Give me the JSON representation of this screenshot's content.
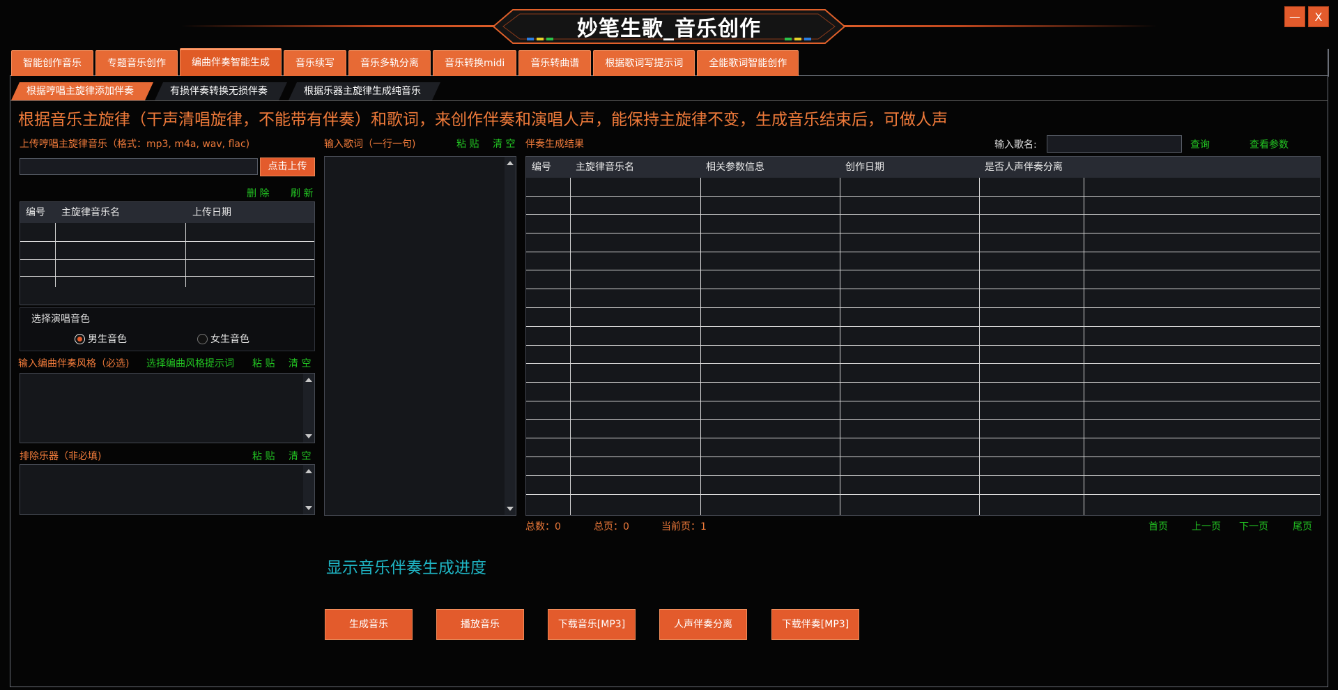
{
  "window": {
    "title": "妙笔生歌_音乐创作",
    "minimize_label": "—",
    "close_label": "X"
  },
  "tabs": [
    {
      "label": "智能创作音乐"
    },
    {
      "label": "专题音乐创作"
    },
    {
      "label": "编曲伴奏智能生成"
    },
    {
      "label": "音乐续写"
    },
    {
      "label": "音乐多轨分离"
    },
    {
      "label": "音乐转换midi"
    },
    {
      "label": "音乐转曲谱"
    },
    {
      "label": "根据歌词写提示词"
    },
    {
      "label": "全能歌词智能创作"
    }
  ],
  "subtabs": [
    {
      "label": "根据哼唱主旋律添加伴奏"
    },
    {
      "label": "有损伴奏转换无损伴奏"
    },
    {
      "label": "根据乐器主旋律生成纯音乐"
    }
  ],
  "description": "根据音乐主旋律（干声清唱旋律，不能带有伴奏）和歌词，来创作伴奏和演唱人声，能保持主旋律不变，生成音乐结束后，可做人声",
  "upload": {
    "label": "上传哼唱主旋律音乐（格式：mp3, m4a, wav, flac)",
    "path_value": "",
    "button": "点击上传",
    "delete": "删 除",
    "refresh": "刷 新",
    "table_headers": [
      "编号",
      "主旋律音乐名",
      "上传日期"
    ]
  },
  "voice": {
    "title": "选择演唱音色",
    "male": "男生音色",
    "female": "女生音色"
  },
  "style": {
    "label": "输入编曲伴奏风格（必选)",
    "prompt_link": "选择编曲风格提示词",
    "paste": "粘 贴",
    "clear": "清 空"
  },
  "exclude": {
    "label": "排除乐器（非必填)",
    "paste": "粘 贴",
    "clear": "清 空"
  },
  "lyrics": {
    "label": "输入歌词（一行一句)",
    "paste": "粘 贴",
    "clear": "清 空"
  },
  "results": {
    "label": "伴奏生成结果",
    "search_label": "输入歌名:",
    "search_value": "",
    "query": "查询",
    "view_params": "查看参数",
    "table_headers": [
      "编号",
      "主旋律音乐名",
      "相关参数信息",
      "创作日期",
      "是否人声伴奏分离"
    ],
    "total": "总数：0",
    "total_pages": "总页：0",
    "current_page": "当前页：1",
    "first": "首页",
    "prev": "上一页",
    "next": "下一页",
    "last": "尾页"
  },
  "progress_text": "显示音乐伴奏生成进度",
  "actions": [
    {
      "label": "生成音乐"
    },
    {
      "label": "播放音乐"
    },
    {
      "label": "下载音乐[MP3]"
    },
    {
      "label": "人声伴奏分离"
    },
    {
      "label": "下载伴奏[MP3]"
    }
  ],
  "colors": {
    "accent": "#e35b2c",
    "link": "#22c322",
    "label": "#ef7a3a",
    "progress": "#1fb5c4"
  }
}
